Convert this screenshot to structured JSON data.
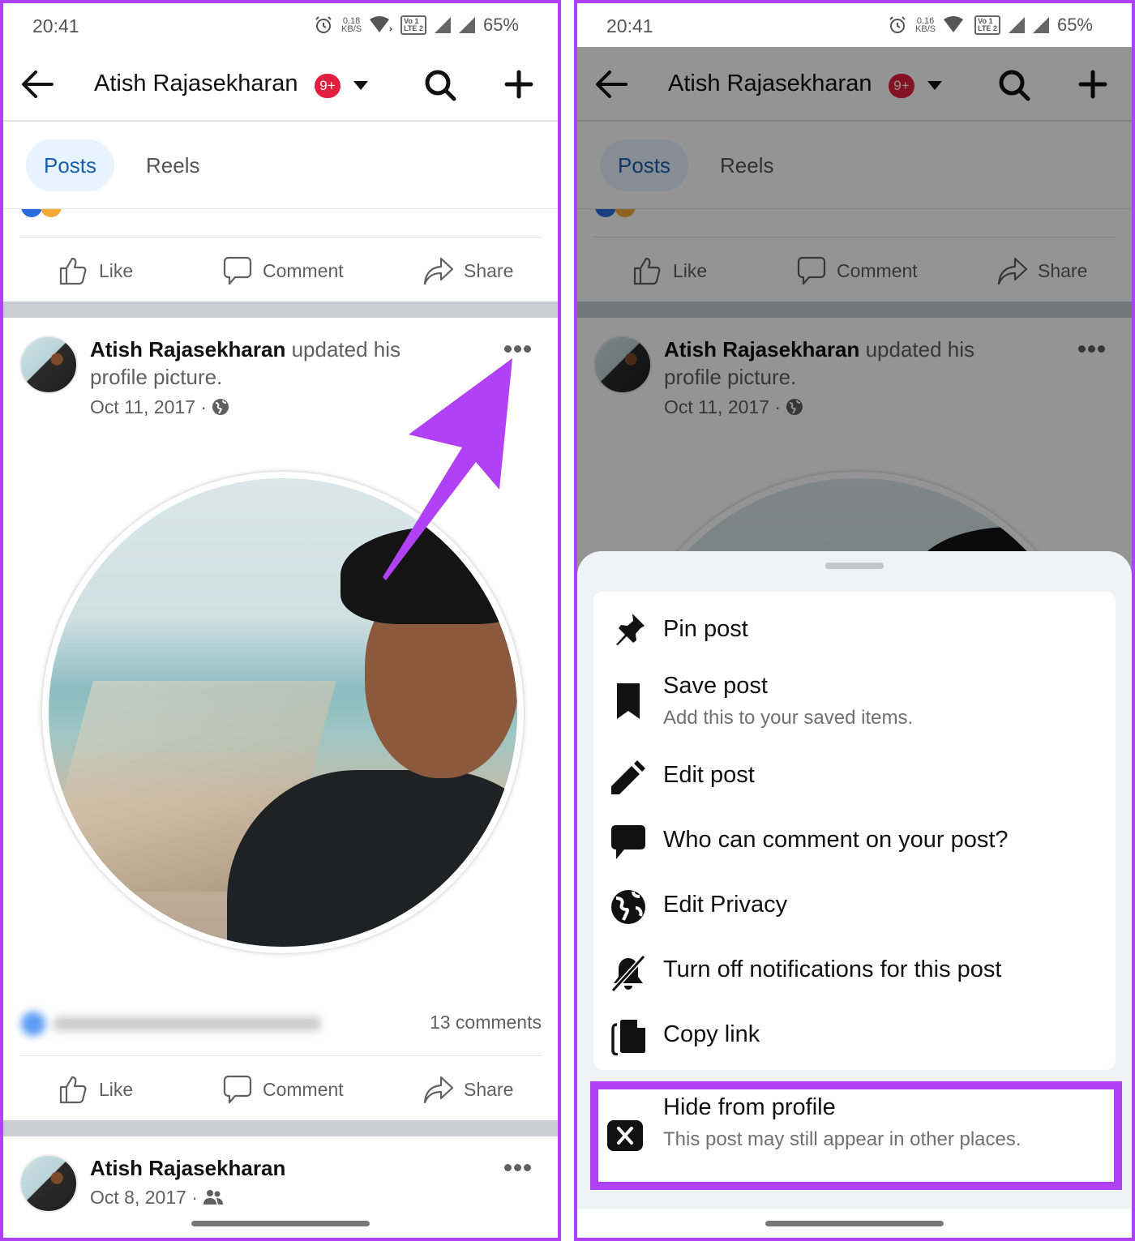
{
  "screens": [
    {
      "status": {
        "time": "20:41",
        "speed": "0.18",
        "speed_unit": "KB/S",
        "lte_top": "Vo 1",
        "lte_bottom": "LTE 2",
        "battery": "65%"
      },
      "appbar": {
        "title": "Atish Rajasekharan",
        "badge": "9+"
      },
      "tabs": [
        {
          "label": "Posts",
          "active": true
        },
        {
          "label": "Reels",
          "active": false
        }
      ],
      "prev_post_actions": {
        "like": "Like",
        "comment": "Comment",
        "share": "Share"
      },
      "post": {
        "author": "Atish Rajasekharan",
        "action_text": "updated his",
        "action_text_2": "profile picture.",
        "date": "Oct 11, 2017 ·",
        "audience_icon": "globe-icon",
        "comments": "13 comments",
        "actions": {
          "like": "Like",
          "comment": "Comment",
          "share": "Share"
        }
      },
      "next_post": {
        "author": "Atish Rajasekharan",
        "date": "Oct 8, 2017 ·",
        "audience_icon": "friends-icon"
      }
    },
    {
      "status": {
        "time": "20:41",
        "speed": "0.16",
        "speed_unit": "KB/S",
        "lte_top": "Vo 1",
        "lte_bottom": "LTE 2",
        "battery": "65%"
      },
      "appbar": {
        "title": "Atish Rajasekharan",
        "badge": "9+"
      },
      "tabs": [
        {
          "label": "Posts",
          "active": true
        },
        {
          "label": "Reels",
          "active": false
        }
      ],
      "prev_post_actions": {
        "like": "Like",
        "comment": "Comment",
        "share": "Share"
      },
      "post": {
        "author": "Atish Rajasekharan",
        "action_text": "updated his",
        "action_text_2": "profile picture.",
        "date": "Oct 11, 2017 ·",
        "audience_icon": "globe-icon"
      },
      "menu": {
        "items": [
          {
            "icon": "pin-icon",
            "label": "Pin post"
          },
          {
            "icon": "bookmark-icon",
            "label": "Save post",
            "sub": "Add this to your saved items."
          },
          {
            "icon": "pencil-icon",
            "label": "Edit post"
          },
          {
            "icon": "speech-bubble-icon",
            "label": "Who can comment on your post?"
          },
          {
            "icon": "globe-icon",
            "label": "Edit Privacy"
          },
          {
            "icon": "bell-off-icon",
            "label": "Turn off notifications for this post"
          },
          {
            "icon": "copy-icon",
            "label": "Copy link"
          }
        ],
        "highlighted": {
          "icon": "close-square-icon",
          "label": "Hide from profile",
          "sub": "This post may still appear in other places."
        }
      }
    }
  ],
  "annotation": {
    "color": "#b041f7"
  },
  "colors": {
    "accent": "#1b5fb1",
    "badge": "#e41e3f",
    "highlight": "#b041f7"
  }
}
